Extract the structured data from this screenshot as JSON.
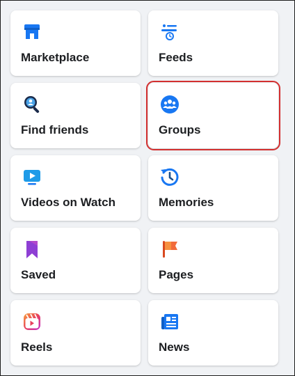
{
  "menu": {
    "items": [
      {
        "label": "Marketplace",
        "icon": "marketplace-icon"
      },
      {
        "label": "Feeds",
        "icon": "feeds-icon"
      },
      {
        "label": "Find friends",
        "icon": "find-friends-icon"
      },
      {
        "label": "Groups",
        "icon": "groups-icon",
        "highlighted": true
      },
      {
        "label": "Videos on Watch",
        "icon": "watch-icon"
      },
      {
        "label": "Memories",
        "icon": "memories-icon"
      },
      {
        "label": "Saved",
        "icon": "saved-icon"
      },
      {
        "label": "Pages",
        "icon": "pages-icon"
      },
      {
        "label": "Reels",
        "icon": "reels-icon"
      },
      {
        "label": "News",
        "icon": "news-icon"
      }
    ]
  },
  "colors": {
    "accent_blue": "#1877f2",
    "light_blue": "#4aa3e8",
    "highlight_border": "#d32f2f",
    "saved_purple": "#8e3fd4",
    "pages_orange": "#f26b3a",
    "reels_pink": "#e8405c"
  }
}
